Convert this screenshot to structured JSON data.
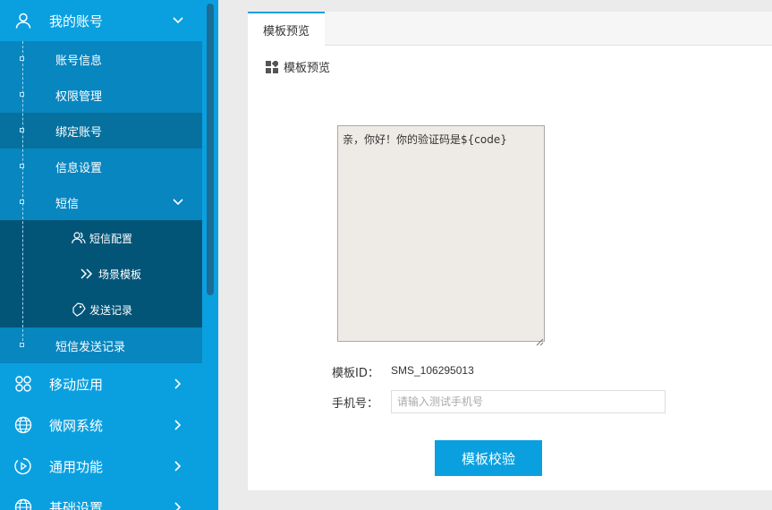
{
  "sidebar": {
    "account": {
      "label": "我的账号",
      "icon": "user-icon"
    },
    "account_items": [
      {
        "label": "账号信息"
      },
      {
        "label": "权限管理"
      },
      {
        "label": "绑定账号"
      },
      {
        "label": "信息设置"
      },
      {
        "label": "短信"
      }
    ],
    "sms_items": [
      {
        "label": "短信配置",
        "icon": "users-icon"
      },
      {
        "label": "场景模板",
        "icon": "double-chevron-right-icon"
      },
      {
        "label": "发送记录",
        "icon": "tag-icon"
      }
    ],
    "sms_send_log": {
      "label": "短信发送记录"
    },
    "top_items": [
      {
        "label": "移动应用",
        "icon": "apps-icon"
      },
      {
        "label": "微网系统",
        "icon": "globe-icon"
      },
      {
        "label": "通用功能",
        "icon": "play-circle-icon"
      },
      {
        "label": "基础设置",
        "icon": "globe-icon"
      }
    ]
  },
  "tab": {
    "label": "模板预览"
  },
  "section": {
    "title": "模板预览",
    "icon": "grid-icon"
  },
  "preview": {
    "content": "亲，你好！你的验证码是${code}"
  },
  "template_id": {
    "label": "模板ID：",
    "value": "SMS_106295013"
  },
  "phone": {
    "label": "手机号：",
    "placeholder": "请输入测试手机号",
    "value": ""
  },
  "verify_button": {
    "label": "模板校验"
  },
  "colors": {
    "accent": "#0aa0e0",
    "sidebar_sub": "#0786c0",
    "sidebar_active": "#06719f",
    "sidebar_deep": "#035578"
  }
}
